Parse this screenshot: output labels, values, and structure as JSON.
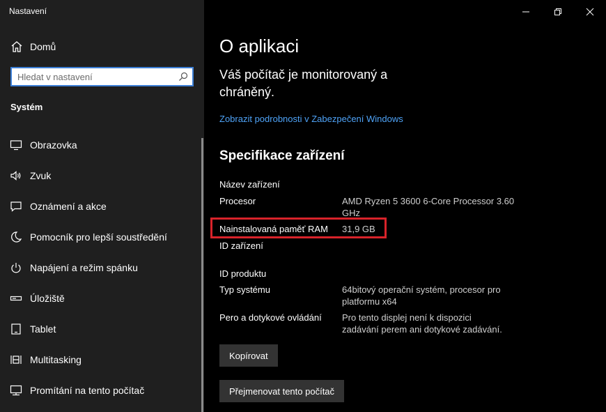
{
  "window": {
    "title": "Nastavení",
    "controls": [
      {
        "name": "minimize-icon"
      },
      {
        "name": "restore-icon"
      },
      {
        "name": "close-icon"
      }
    ]
  },
  "sidebar": {
    "home_label": "Domů",
    "home_icon": "home-icon",
    "search_placeholder": "Hledat v nastavení",
    "search_icon": "search-icon",
    "section_title": "Systém",
    "items": [
      {
        "label": "Obrazovka",
        "icon": "monitor-icon"
      },
      {
        "label": "Zvuk",
        "icon": "speaker-icon"
      },
      {
        "label": "Oznámení a akce",
        "icon": "notification-icon"
      },
      {
        "label": "Pomocník pro lepší soustředění",
        "icon": "moon-icon"
      },
      {
        "label": "Napájení a režim spánku",
        "icon": "power-icon"
      },
      {
        "label": "Úložiště",
        "icon": "storage-icon"
      },
      {
        "label": "Tablet",
        "icon": "tablet-icon"
      },
      {
        "label": "Multitasking",
        "icon": "multitasking-icon"
      },
      {
        "label": "Promítání na tento počítač",
        "icon": "projecting-icon"
      }
    ]
  },
  "main": {
    "title": "O aplikaci",
    "status": "Váš počítač je monitorovaný a chráněný.",
    "security_link": "Zobrazit podrobnosti v Zabezpečení Windows",
    "spec_title": "Specifikace zařízení",
    "specs": [
      {
        "key": "Název zařízení",
        "value": ""
      },
      {
        "key": "Procesor",
        "value": "AMD Ryzen 5 3600 6-Core Processor 3.60 GHz"
      },
      {
        "key": "Nainstalovaná paměť RAM",
        "value": "31,9 GB"
      },
      {
        "key": "ID zařízení",
        "value": ""
      },
      {
        "key": "ID produktu",
        "value": ""
      },
      {
        "key": "Typ systému",
        "value": "64bitový operační systém, procesor pro platformu x64"
      },
      {
        "key": "Pero a dotykové ovládání",
        "value": "Pro tento displej není k dispozici zadávání perem ani dotykové zadávání."
      }
    ],
    "copy_button": "Kopírovat",
    "rename_button": "Přejmenovat tento počítač",
    "highlight_color": "#d8232a"
  }
}
